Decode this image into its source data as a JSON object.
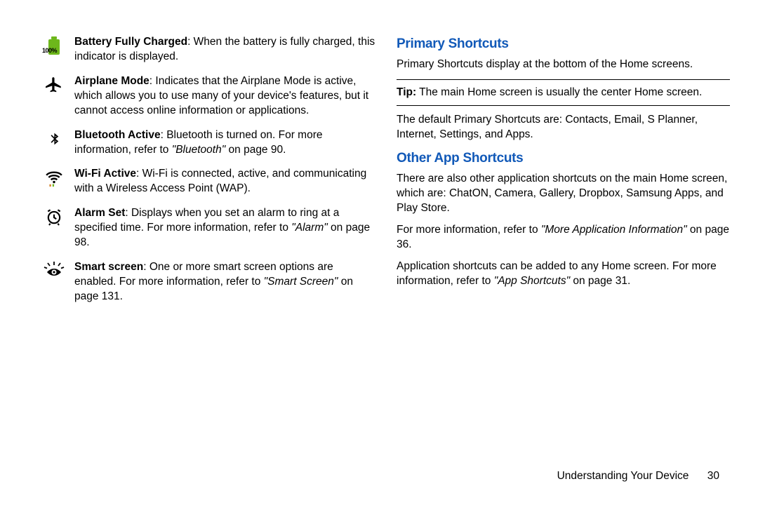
{
  "left_items": [
    {
      "icon": "battery-full-100",
      "title": "Battery Fully Charged",
      "body_a": ": When the battery is fully charged, this indicator is displayed."
    },
    {
      "icon": "airplane",
      "title": "Airplane Mode",
      "body_a": ": Indicates that the Airplane Mode is active, which allows you to use many of your device's features, but it cannot access online information or applications."
    },
    {
      "icon": "bluetooth",
      "title": "Bluetooth Active",
      "body_a": ": Bluetooth is turned on. For more information, refer to ",
      "ref_ital": "\"Bluetooth\"",
      "body_b": " on page 90."
    },
    {
      "icon": "wifi",
      "title": "Wi-Fi Active",
      "body_a": ": Wi-Fi is connected, active, and communicating with a Wireless Access Point (WAP)."
    },
    {
      "icon": "alarm",
      "title": "Alarm Set",
      "body_a": ": Displays when you set an alarm to ring at a specified time. For more information, refer to ",
      "ref_ital": "\"Alarm\"",
      "body_b": " on page 98."
    },
    {
      "icon": "smart-screen",
      "title": "Smart screen",
      "body_a": ": One or more smart screen options are enabled. For more information, refer to ",
      "ref_ital": "\"Smart Screen\"",
      "body_b": " on page 131."
    }
  ],
  "right": {
    "h1": "Primary Shortcuts",
    "p1": "Primary Shortcuts display at the bottom of the Home screens.",
    "tip_label": "Tip:",
    "tip_body": " The main Home screen is usually the center Home screen.",
    "p2": "The default Primary Shortcuts are: Contacts, Email, S Planner, Internet, Settings, and Apps.",
    "h2": "Other App Shortcuts",
    "p3": "There are also other application shortcuts on the main Home screen, which are: ChatON, Camera, Gallery, Dropbox, Samsung Apps, and Play Store.",
    "p4a": "For more information, refer to ",
    "p4ref": "\"More Application Information\"",
    "p4b": " on page 36.",
    "p5a": "Application shortcuts can be added to any Home screen. For more information, refer to ",
    "p5ref": "\"App Shortcuts\"",
    "p5b": " on page 31."
  },
  "footer": {
    "section": "Understanding Your Device",
    "page": "30"
  }
}
